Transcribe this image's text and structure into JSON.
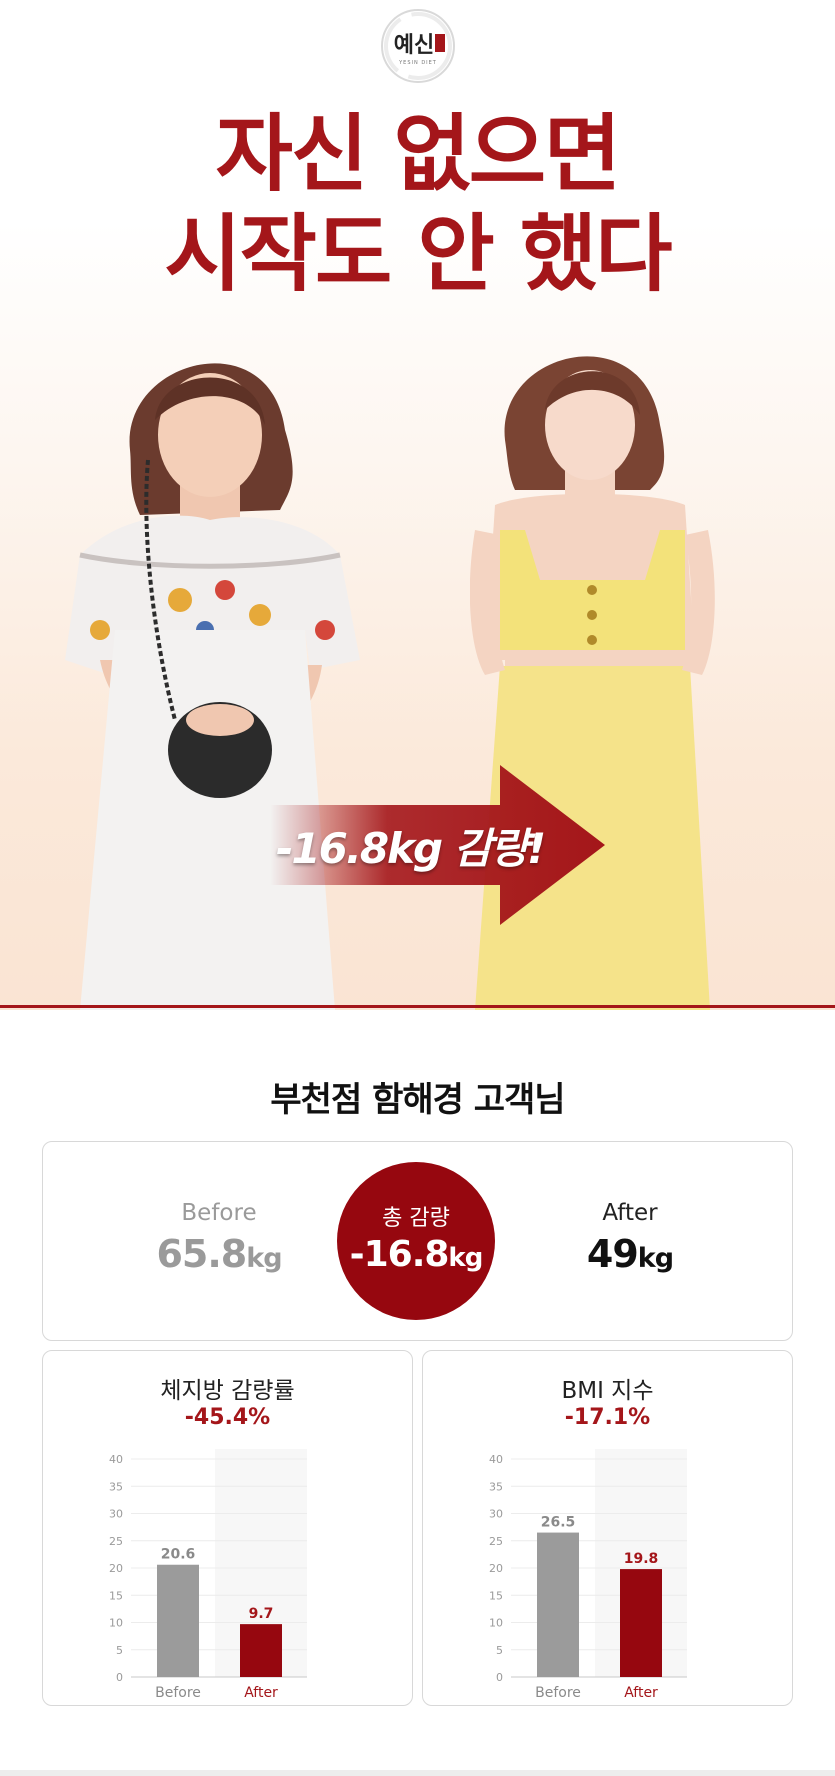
{
  "brand": {
    "logo_text": "예신",
    "logo_subtext": "YESIN DIET",
    "logo_badge": "다이어트"
  },
  "headline": {
    "line1": "자신 없으면",
    "line2": "시작도 안 했다"
  },
  "hero": {
    "result_text": "-16.8kg 감량!"
  },
  "customer": {
    "title": "부천점 함해경 고객님"
  },
  "summary": {
    "before_label": "Before",
    "before_value": "65.8",
    "before_unit": "kg",
    "total_label": "총 감량",
    "total_value": "-16.8",
    "total_unit": "kg",
    "after_label": "After",
    "after_value": "49",
    "after_unit": "kg"
  },
  "colors": {
    "accent": "#a4161a",
    "accent_dark": "#96070f",
    "before_bar": "#9b9b9b",
    "after_bar": "#96070f"
  },
  "stats": [
    {
      "title": "체지방 감량률",
      "change": "-45.4%"
    },
    {
      "title": "BMI 지수",
      "change": "-17.1%"
    }
  ],
  "chart_data": [
    {
      "type": "bar",
      "categories": [
        "Before",
        "After"
      ],
      "values": [
        20.6,
        9.7
      ],
      "title": "체지방 감량률",
      "subtitle": "-45.4%",
      "ylim": [
        0,
        40
      ],
      "yticks": [
        0,
        5,
        10,
        15,
        20,
        25,
        30,
        35,
        40
      ],
      "grid": true
    },
    {
      "type": "bar",
      "categories": [
        "Before",
        "After"
      ],
      "values": [
        26.5,
        19.8
      ],
      "title": "BMI 지수",
      "subtitle": "-17.1%",
      "ylim": [
        0,
        40
      ],
      "yticks": [
        0,
        5,
        10,
        15,
        20,
        25,
        30,
        35,
        40
      ],
      "grid": true
    }
  ]
}
